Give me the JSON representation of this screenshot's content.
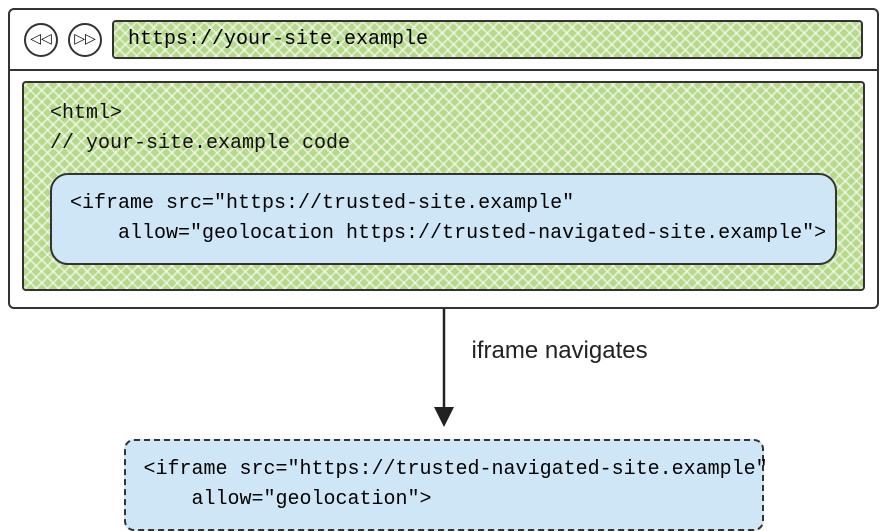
{
  "browser": {
    "back_glyph": "◁◁",
    "forward_glyph": "▷▷",
    "url": "https://your-site.example"
  },
  "page": {
    "code_lines": "<html>\n// your-site.example code",
    "iframe_code": "<iframe src=\"https://trusted-site.example\"\n    allow=\"geolocation https://trusted-navigated-site.example\">"
  },
  "arrow_label": "iframe navigates",
  "navigated": {
    "iframe_code": "<iframe src=\"https://trusted-navigated-site.example\"\n    allow=\"geolocation\">"
  },
  "colors": {
    "green_fill": "#b7d98c",
    "blue_fill": "#cfe6f7",
    "stroke": "#333333"
  }
}
